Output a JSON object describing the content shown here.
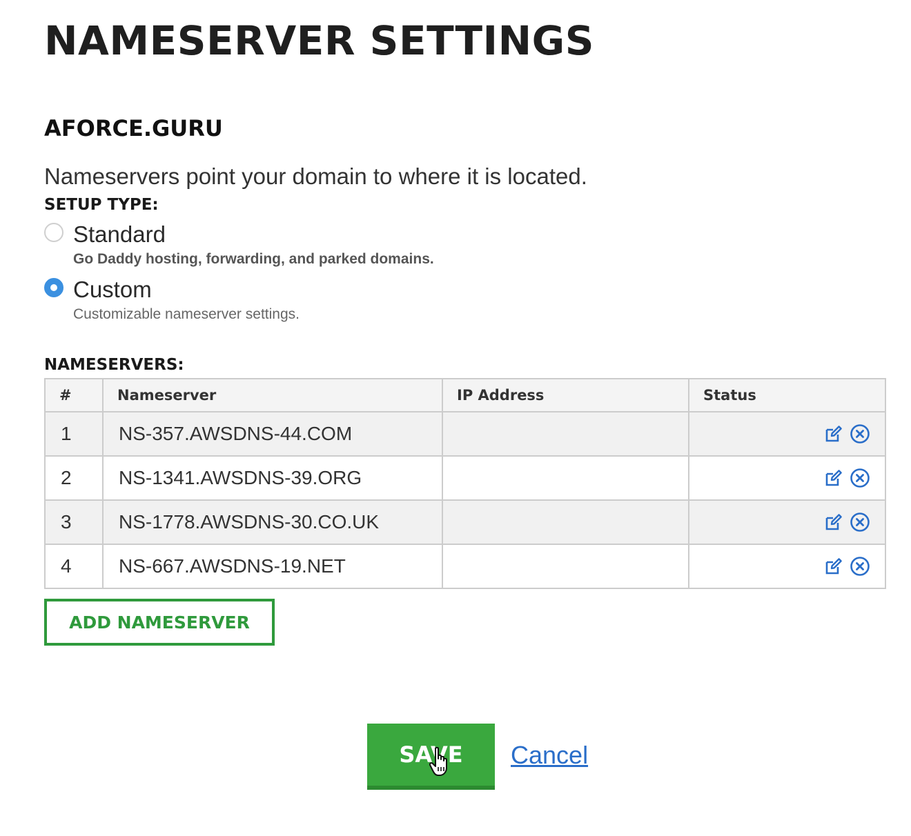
{
  "page": {
    "title": "NAMESERVER SETTINGS",
    "domain": "AFORCE.GURU",
    "description": "Nameservers point your domain to where it is located."
  },
  "setup": {
    "label": "SETUP TYPE:",
    "options": [
      {
        "label": "Standard",
        "help": "Go Daddy hosting, forwarding, and parked domains.",
        "selected": false
      },
      {
        "label": "Custom",
        "help": "Customizable nameserver settings.",
        "selected": true
      }
    ]
  },
  "nameservers": {
    "label": "NAMESERVERS:",
    "columns": [
      "#",
      "Nameserver",
      "IP Address",
      "Status"
    ],
    "rows": [
      {
        "num": "1",
        "nameserver": "NS-357.AWSDNS-44.COM",
        "ip": "",
        "status": ""
      },
      {
        "num": "2",
        "nameserver": "NS-1341.AWSDNS-39.ORG",
        "ip": "",
        "status": ""
      },
      {
        "num": "3",
        "nameserver": "NS-1778.AWSDNS-30.CO.UK",
        "ip": "",
        "status": ""
      },
      {
        "num": "4",
        "nameserver": "NS-667.AWSDNS-19.NET",
        "ip": "",
        "status": ""
      }
    ],
    "row_icons": [
      "edit-icon",
      "remove-circle-icon"
    ]
  },
  "actions": {
    "add_label": "ADD NAMESERVER",
    "save_label": "SAVE",
    "cancel_label": "Cancel"
  },
  "colors": {
    "accent_green": "#3aa83e",
    "outline_green": "#2f9a3c",
    "radio_blue": "#3b90e0",
    "link_blue": "#2a6ec9",
    "icon_blue": "#2a6ec9"
  }
}
